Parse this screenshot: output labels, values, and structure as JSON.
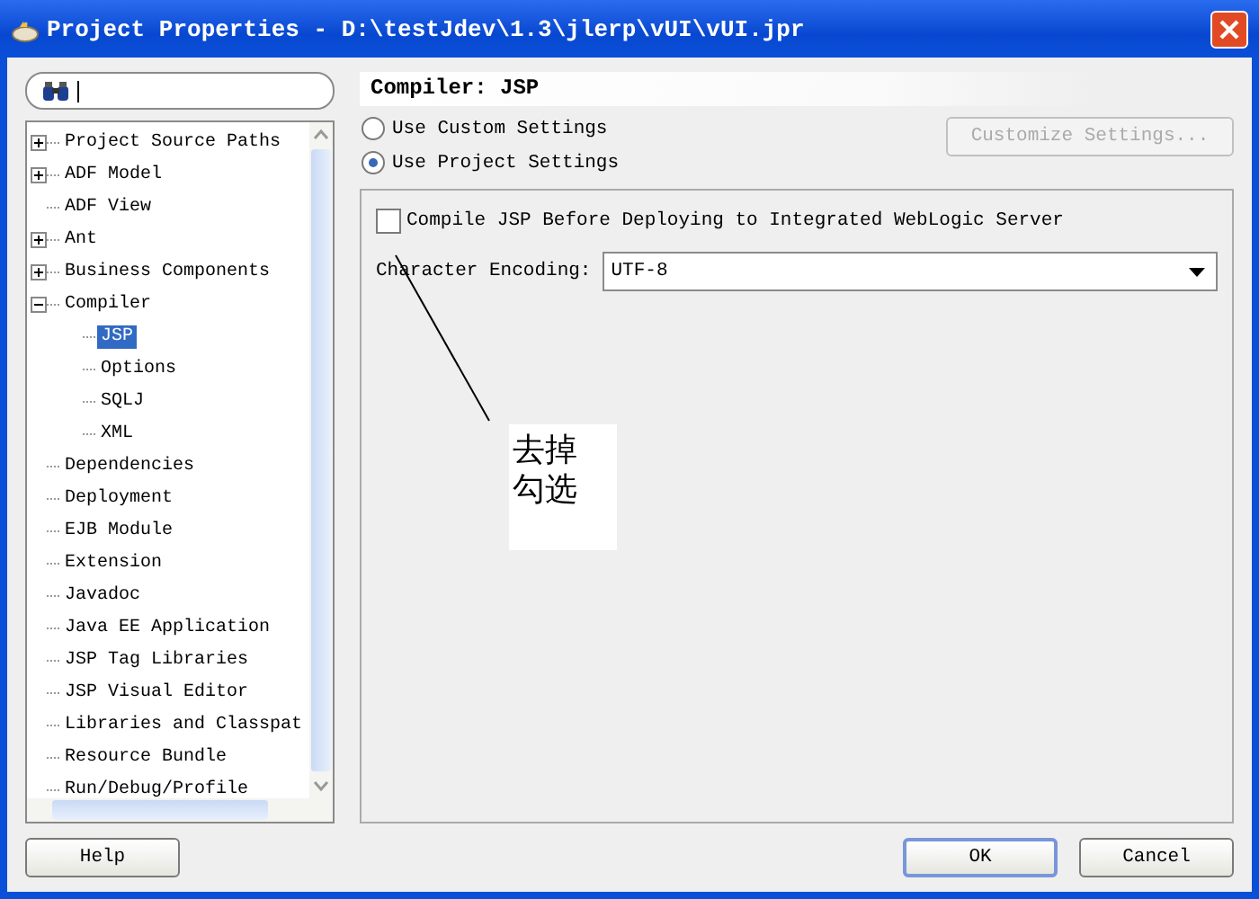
{
  "window": {
    "title": "Project Properties - D:\\testJdev\\1.3\\jlerp\\vUI\\vUI.jpr"
  },
  "tree": [
    {
      "label": "Project Source Paths",
      "expanded": false
    },
    {
      "label": "ADF Model",
      "expanded": false
    },
    {
      "label": "ADF View",
      "selected": false
    },
    {
      "label": "Ant",
      "expanded": false
    },
    {
      "label": "Business Components",
      "expanded": false
    },
    {
      "label": "Compiler",
      "expanded": true,
      "children": [
        {
          "label": "JSP",
          "selected": true
        },
        {
          "label": "Options",
          "selected": false
        },
        {
          "label": "SQLJ",
          "selected": false
        },
        {
          "label": "XML",
          "selected": false
        }
      ]
    },
    {
      "label": "Dependencies",
      "selected": false
    },
    {
      "label": "Deployment",
      "selected": false
    },
    {
      "label": "EJB Module",
      "selected": false
    },
    {
      "label": "Extension",
      "selected": false
    },
    {
      "label": "Javadoc",
      "selected": false
    },
    {
      "label": "Java EE Application",
      "selected": false
    },
    {
      "label": "JSP Tag Libraries",
      "selected": false
    },
    {
      "label": "JSP Visual Editor",
      "selected": false
    },
    {
      "label": "Libraries and Classpat",
      "selected": false
    },
    {
      "label": "Resource Bundle",
      "selected": false
    },
    {
      "label": "Run/Debug/Profile",
      "selected": false
    }
  ],
  "page_title": "Compiler: JSP",
  "settings": [
    {
      "label": "Use Custom Settings",
      "selected": false
    },
    {
      "label": "Use Project Settings",
      "selected": true
    }
  ],
  "customize_button": {
    "label": "Customize Settings...",
    "disabled": true
  },
  "compile_checkbox": {
    "label": "Compile JSP Before Deploying to Integrated WebLogic Server",
    "checked": false
  },
  "encoding": {
    "label": "Character Encoding:",
    "value": "UTF-8"
  },
  "annotation": {
    "text": "去掉勾选"
  },
  "buttons": [
    {
      "label": "Help",
      "default": false
    },
    {
      "label": "OK",
      "default": true
    },
    {
      "label": "Cancel",
      "default": false
    }
  ]
}
